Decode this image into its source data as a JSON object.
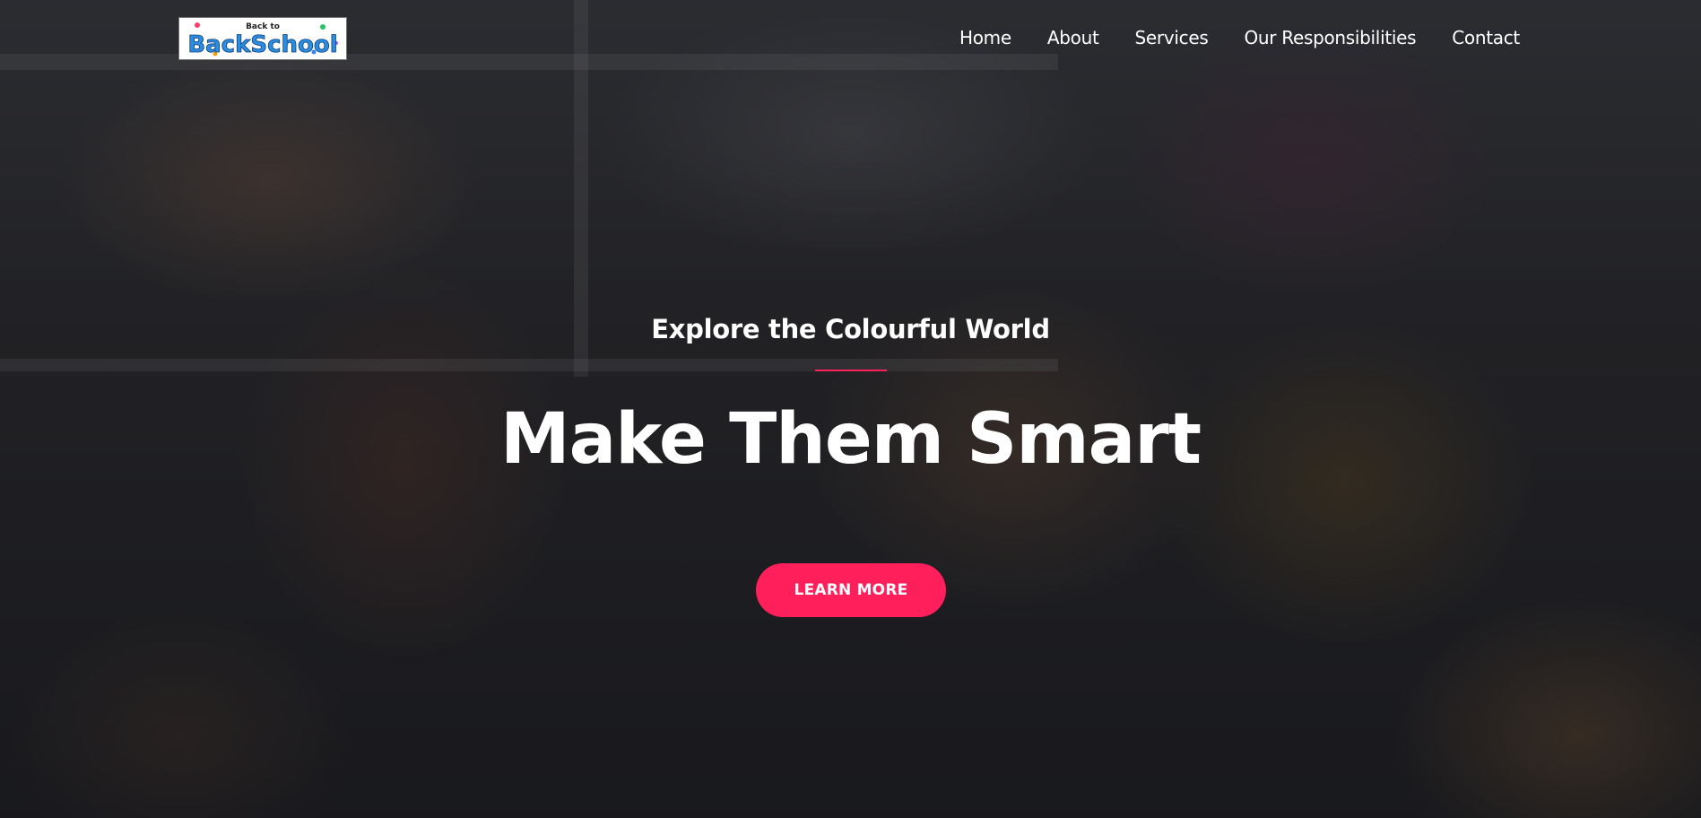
{
  "logo": {
    "small_text": "Back to",
    "main_text": "BackSchool"
  },
  "nav": {
    "items": [
      {
        "label": "Home"
      },
      {
        "label": "About"
      },
      {
        "label": "Services"
      },
      {
        "label": "Our Responsibilities"
      },
      {
        "label": "Contact"
      }
    ]
  },
  "hero": {
    "subtitle": "Explore the Colourful World",
    "headline": "Make Them Smart",
    "cta_label": "LEARN MORE",
    "accent_color": "#ff1f5a",
    "background_image": "classroom-children-raising-hands"
  }
}
